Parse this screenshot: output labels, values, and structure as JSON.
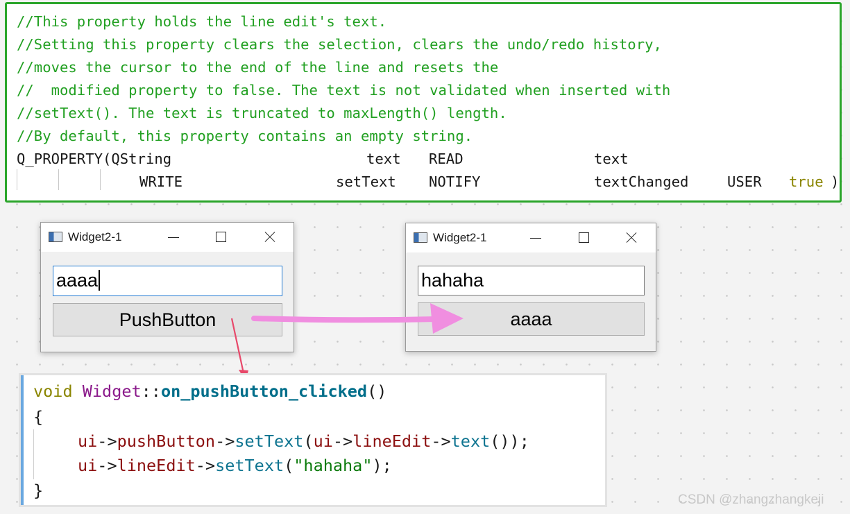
{
  "doc_comment": {
    "lines": [
      "//This property holds the line edit's text.",
      "//Setting this property clears the selection, clears the undo/redo history,",
      "//moves the cursor to the end of the line and resets the",
      "//  modified property to false. The text is not validated when inserted with",
      "//setText(). The text is truncated to maxLength() length.",
      "//By default, this property contains an empty string."
    ],
    "property_line": {
      "macro": "Q_PROPERTY(QString",
      "name": "text",
      "read_kw": "READ",
      "read_fn": "text"
    },
    "write_line": {
      "write_kw": "WRITE",
      "write_fn": "setText",
      "notify_kw": "NOTIFY",
      "notify_fn": "textChanged",
      "user_kw": "USER",
      "user_val": "true",
      "close": ")"
    }
  },
  "window_before": {
    "title": "Widget2-1",
    "line_edit_value": "aaaa",
    "button_label": "PushButton"
  },
  "window_after": {
    "title": "Widget2-1",
    "line_edit_value": "hahaha",
    "button_label": "aaaa"
  },
  "slot_code": {
    "sig_void": "void",
    "sig_class": "Widget",
    "sig_sep": "::",
    "sig_method": "on_pushButton_clicked",
    "sig_parens": "()",
    "open_brace": "{",
    "close_brace": "}",
    "line1": {
      "ui": "ui",
      "arrow1": "->",
      "member": "pushButton",
      "arrow2": "->",
      "method": "setText",
      "p1": "(",
      "ui2": "ui",
      "arrow3": "->",
      "member2": "lineEdit",
      "arrow4": "->",
      "method2": "text",
      "end": "());"
    },
    "line2": {
      "ui": "ui",
      "arrow1": "->",
      "member": "lineEdit",
      "arrow2": "->",
      "method": "setText",
      "p1": "(",
      "str": "\"hahaha\"",
      "end": ");"
    }
  },
  "watermark": "CSDN @zhangzhangkeji",
  "colors": {
    "comment": "#22a022",
    "frame": "#2aa52a",
    "arrow_pink": "#f08ee0",
    "arrow_red": "#e8486a"
  }
}
